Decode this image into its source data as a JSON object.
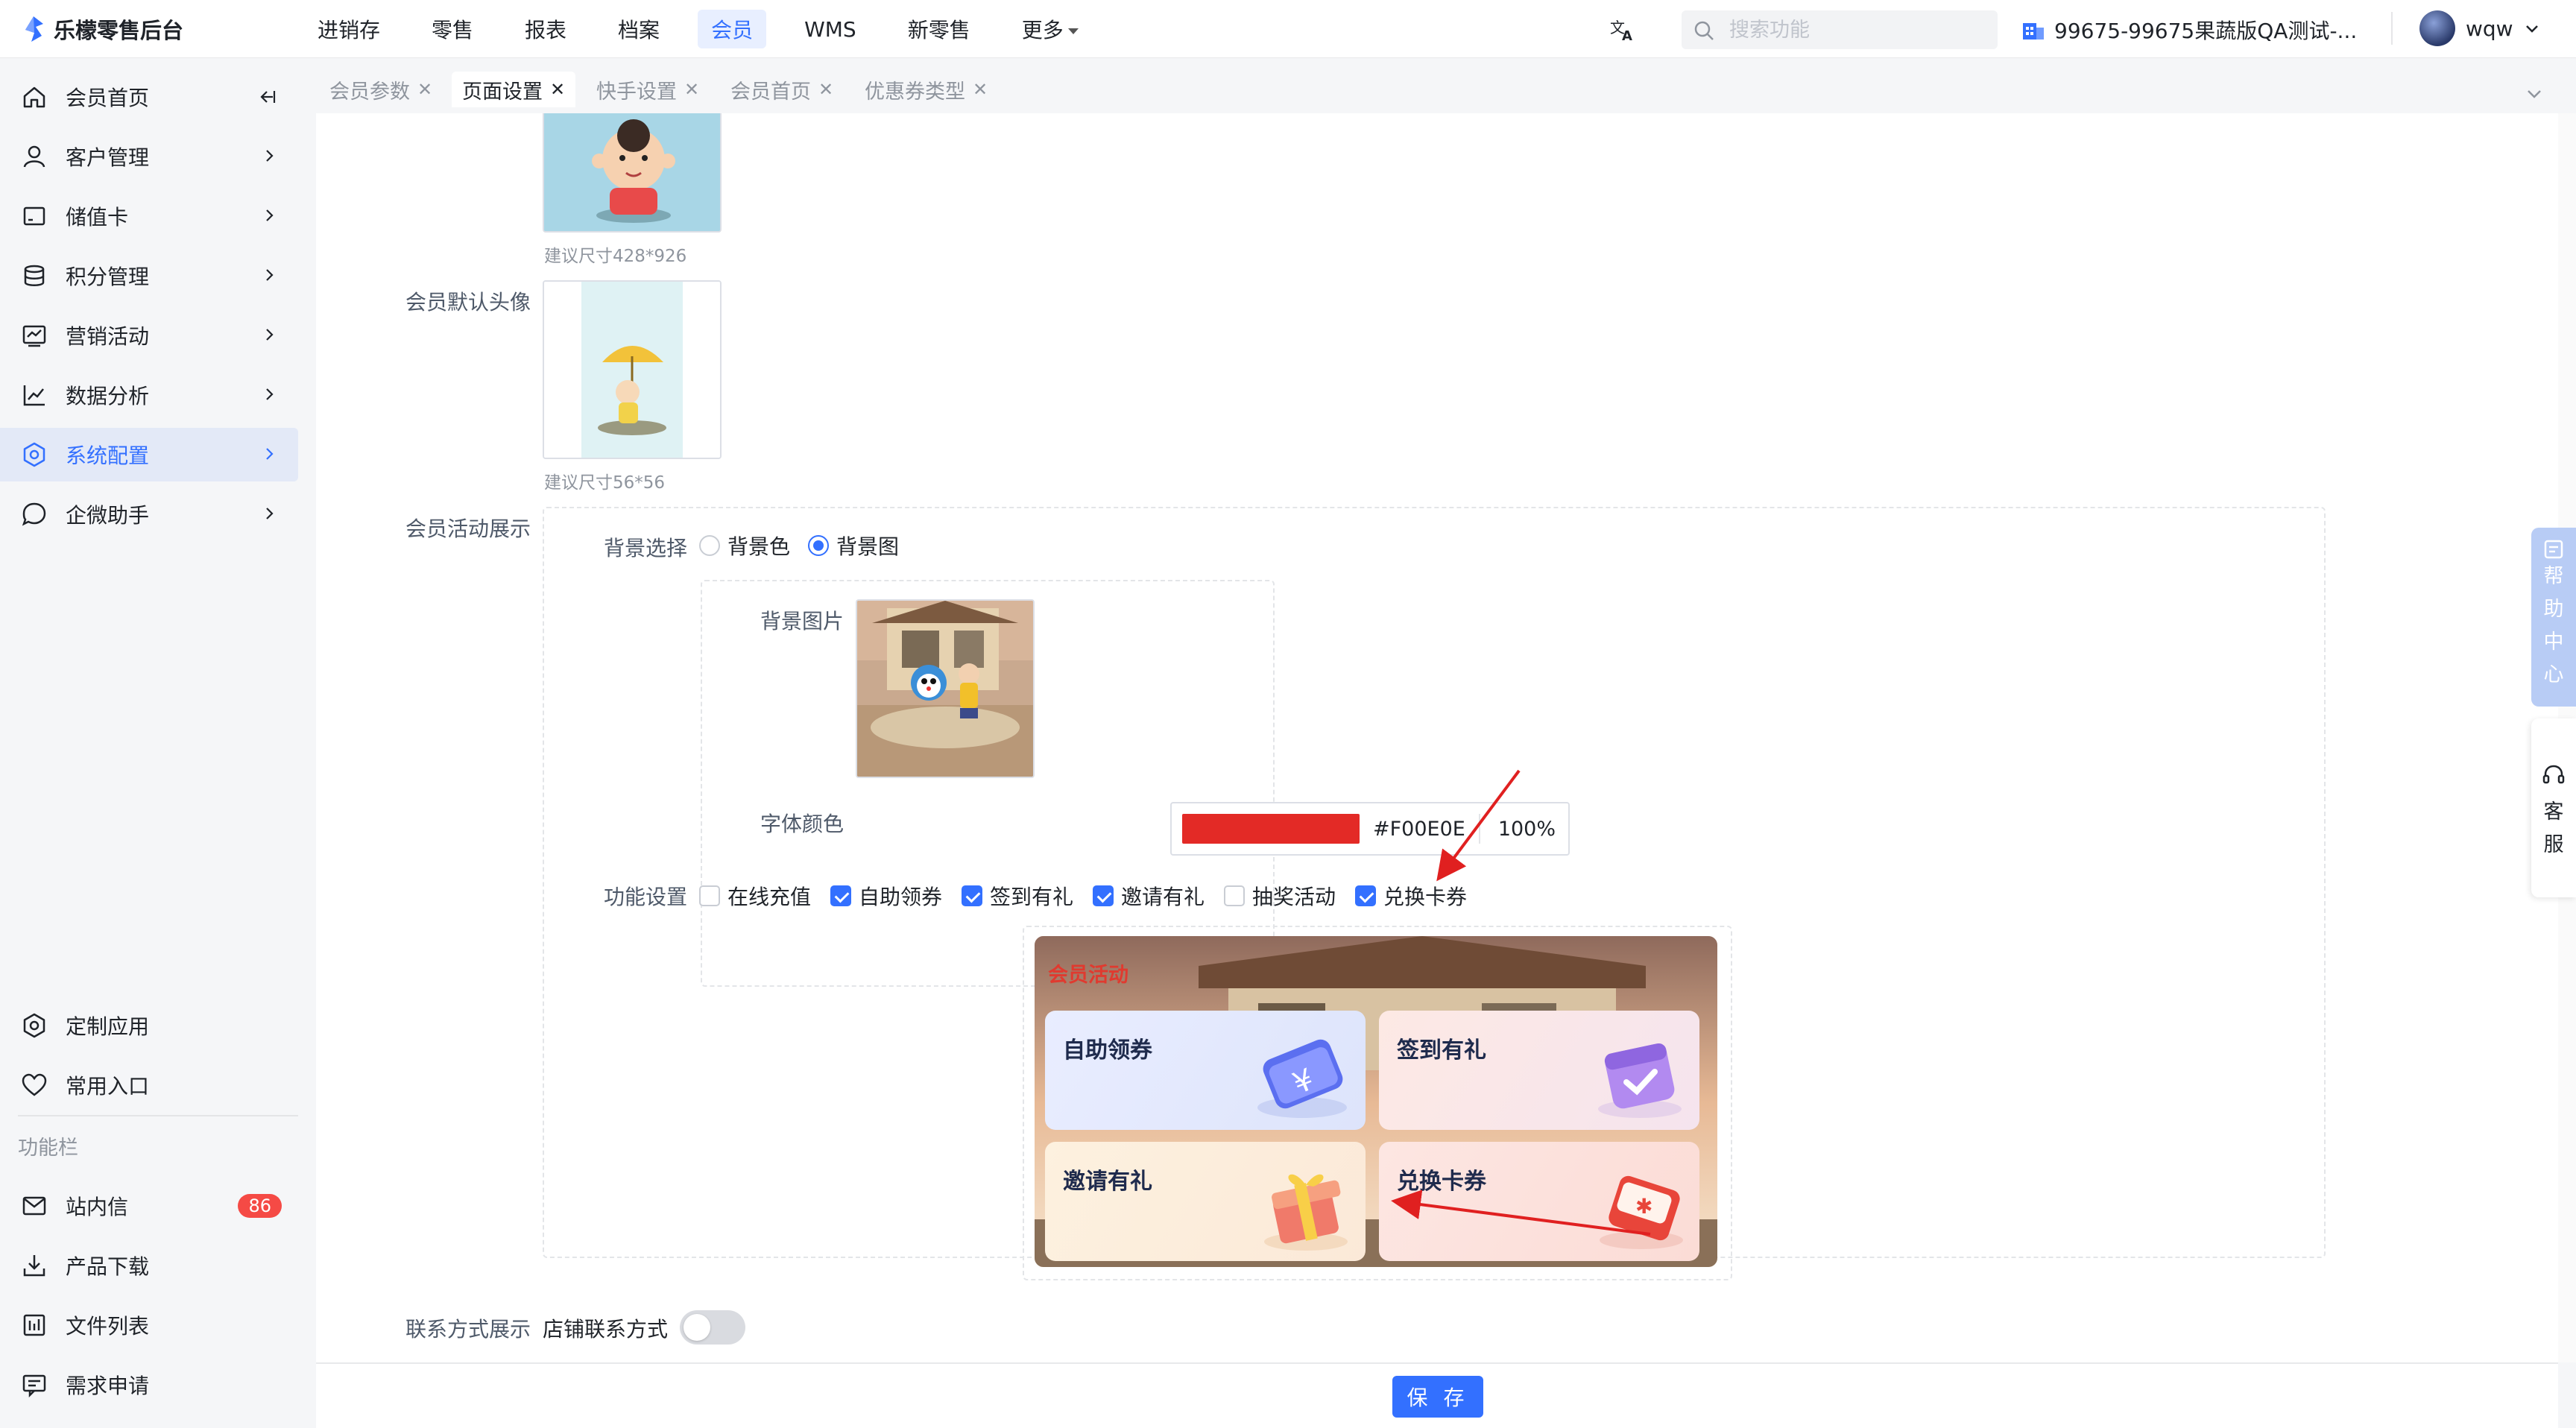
{
  "brand": {
    "title": "乐檬零售后台"
  },
  "nav": {
    "items": [
      "进销存",
      "零售",
      "报表",
      "档案",
      "会员",
      "WMS",
      "新零售",
      "更多"
    ],
    "active": "会员"
  },
  "search": {
    "placeholder": "搜索功能"
  },
  "store": {
    "name": "99675-99675果蔬版QA测试-..."
  },
  "user": {
    "name": "wqw"
  },
  "sidebar": {
    "items": [
      {
        "label": "会员首页",
        "icon": "home-icon"
      },
      {
        "label": "客户管理",
        "icon": "user-icon"
      },
      {
        "label": "储值卡",
        "icon": "card-icon"
      },
      {
        "label": "积分管理",
        "icon": "database-icon"
      },
      {
        "label": "营销活动",
        "icon": "marketing-icon"
      },
      {
        "label": "数据分析",
        "icon": "chart-icon"
      },
      {
        "label": "系统配置",
        "icon": "settings-icon"
      },
      {
        "label": "企微助手",
        "icon": "chat-icon"
      }
    ],
    "bottom_items": [
      {
        "label": "定制应用",
        "icon": "cube-icon"
      },
      {
        "label": "常用入口",
        "icon": "heart-icon"
      }
    ],
    "section_heading": "功能栏",
    "tool_items": [
      {
        "label": "站内信",
        "icon": "mail-icon",
        "badge": "86"
      },
      {
        "label": "产品下载",
        "icon": "download-icon"
      },
      {
        "label": "文件列表",
        "icon": "file-list-icon"
      },
      {
        "label": "需求申请",
        "icon": "request-icon"
      }
    ]
  },
  "tabs": [
    {
      "label": "会员参数",
      "active": false
    },
    {
      "label": "页面设置",
      "active": true
    },
    {
      "label": "快手设置",
      "active": false
    },
    {
      "label": "会员首页",
      "active": false
    },
    {
      "label": "优惠券类型",
      "active": false
    }
  ],
  "form": {
    "bg_hint": "建议尺寸428*926",
    "avatar_label": "会员默认头像",
    "avatar_hint": "建议尺寸56*56",
    "activity_label": "会员活动展示",
    "bg_select_label": "背景选择",
    "bg_options": [
      "背景色",
      "背景图"
    ],
    "bg_selected": "背景图",
    "bg_image_label": "背景图片",
    "font_color_label": "字体颜色",
    "font_color_hex": "#F00E0E",
    "font_color_alpha": "100%",
    "feature_label": "功能设置",
    "features": [
      {
        "label": "在线充值",
        "checked": false
      },
      {
        "label": "自助领券",
        "checked": true
      },
      {
        "label": "签到有礼",
        "checked": true
      },
      {
        "label": "邀请有礼",
        "checked": true
      },
      {
        "label": "抽奖活动",
        "checked": false
      },
      {
        "label": "兑换卡券",
        "checked": true
      }
    ],
    "contact_label": "联系方式展示",
    "contact_toggle_label": "店铺联系方式",
    "contact_enabled": false
  },
  "preview": {
    "title": "会员活动",
    "cards": [
      "自助领券",
      "签到有礼",
      "邀请有礼",
      "兑换卡券"
    ]
  },
  "footer": {
    "save_label": "保 存"
  },
  "float": {
    "help": [
      "帮",
      "助",
      "中",
      "心"
    ],
    "service": [
      "客",
      "服"
    ]
  },
  "colors": {
    "accent": "#3370ff",
    "font_color": "#F00E0E",
    "badge": "#f54a45",
    "annotation": "#e02020"
  }
}
